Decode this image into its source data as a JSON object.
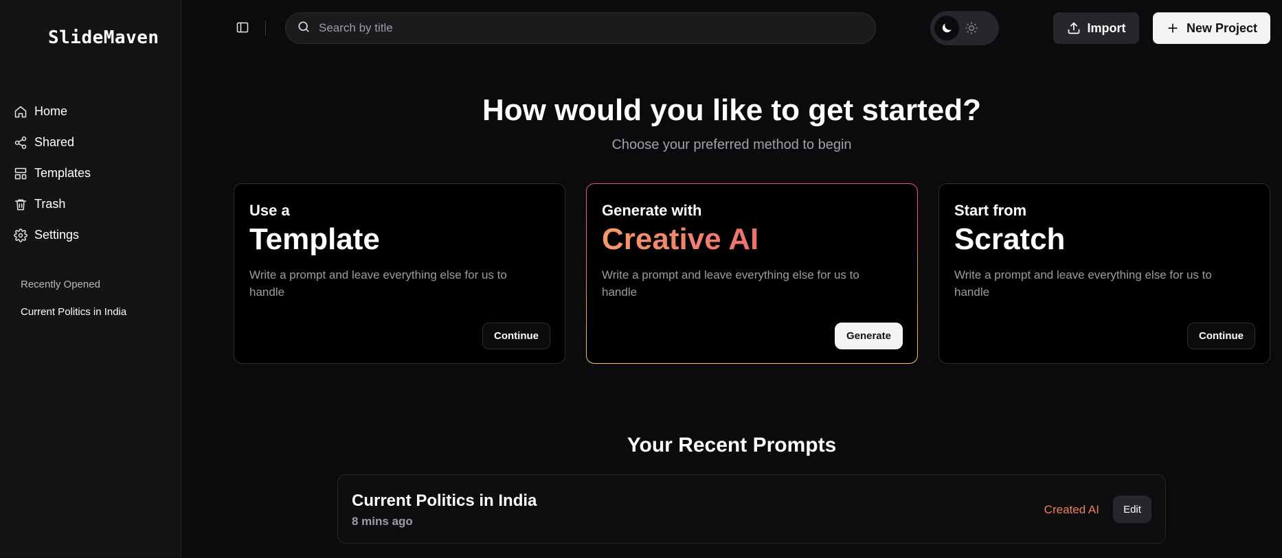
{
  "app": {
    "name": "SlideMaven"
  },
  "sidebar": {
    "items": [
      {
        "label": "Home",
        "icon": "home-icon"
      },
      {
        "label": "Shared",
        "icon": "share-icon"
      },
      {
        "label": "Templates",
        "icon": "layout-icon"
      },
      {
        "label": "Trash",
        "icon": "trash-icon"
      },
      {
        "label": "Settings",
        "icon": "gear-icon"
      }
    ],
    "recent_heading": "Recently Opened",
    "recent_items": [
      "Current Politics in India"
    ]
  },
  "topbar": {
    "search_placeholder": "Search by title",
    "theme": {
      "active": "dark",
      "options": [
        "moon-icon",
        "sun-icon"
      ]
    },
    "import_label": "Import",
    "new_project_label": "New Project"
  },
  "hero": {
    "title": "How would you like to get started?",
    "subtitle": "Choose your preferred method to begin"
  },
  "cards": [
    {
      "pre": "Use a",
      "big": "Template",
      "desc": "Write a prompt and leave everything else for us to handle",
      "cta": "Continue"
    },
    {
      "pre": "Generate with",
      "big": "Creative AI",
      "desc": "Write a prompt and leave everything else for us to handle",
      "cta": "Generate"
    },
    {
      "pre": "Start from",
      "big": "Scratch",
      "desc": "Write a prompt and leave everything else for us to handle",
      "cta": "Continue"
    }
  ],
  "recent_prompts": {
    "title": "Your Recent Prompts",
    "items": [
      {
        "title": "Current Politics in India",
        "time": "8 mins ago",
        "status": "Created AI",
        "action": "Edit"
      }
    ]
  },
  "colors": {
    "background": "#0b0b0d",
    "sidebar": "#141416",
    "accent_gradient": [
      "#f59a6c",
      "#ee6f6f"
    ],
    "status": "#e9805f"
  }
}
